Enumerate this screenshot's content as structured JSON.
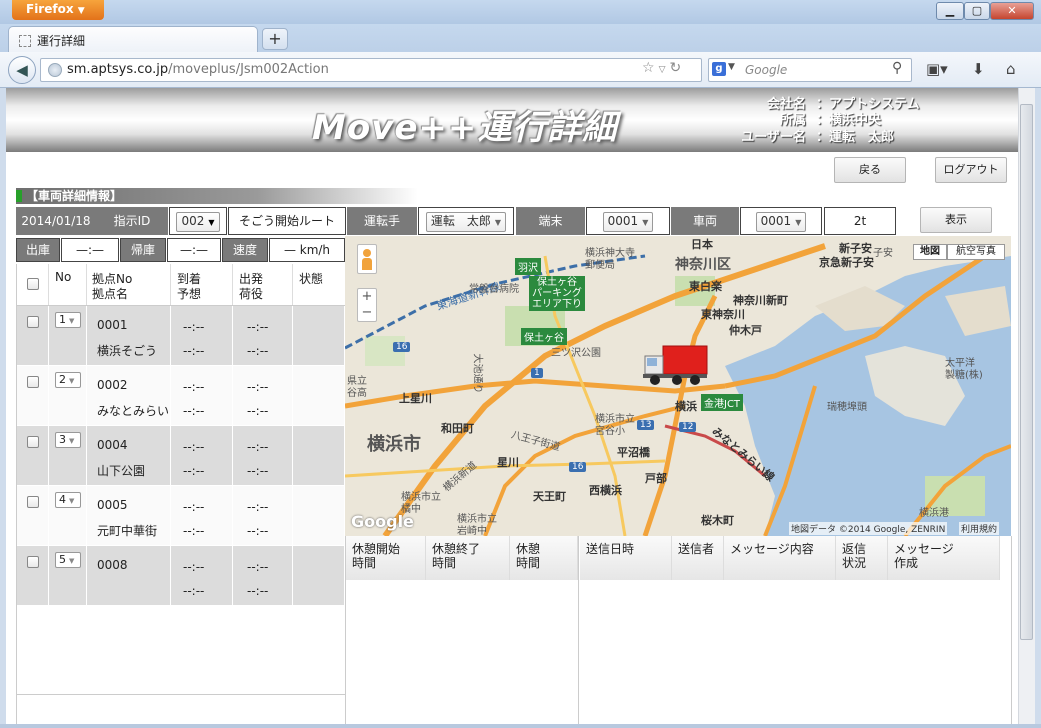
{
  "browser": {
    "app_button": "Firefox",
    "tab_title": "運行詳細",
    "url_domain": "sm.aptsys.co.jp",
    "url_path": "/moveplus/Jsm002Action",
    "search_placeholder": "Google"
  },
  "header": {
    "app_title": "Move++運行詳細",
    "company_label": "会社名",
    "company_value": "：アプトシステム",
    "branch_label": "所属",
    "branch_value": "：横浜中央",
    "user_label": "ユーザー名",
    "user_value": "：運転　太郎"
  },
  "actions": {
    "back_label": "戻る",
    "logout_label": "ログアウト",
    "display_label": "表示"
  },
  "section_title": "【車両詳細情報】",
  "info_row": {
    "date": "2014/01/18",
    "instruction_id_label": "指示ID",
    "instruction_id_value": "002",
    "route_name": "そごう開始ルート",
    "driver_label": "運転手",
    "driver_value": "運転　太郎",
    "terminal_label": "端末",
    "terminal_value": "0001",
    "vehicle_label": "車両",
    "vehicle_value": "0001",
    "tonnage": "2t"
  },
  "status_row": {
    "depart_label": "出庫",
    "depart_value": "—:—",
    "return_label": "帰庫",
    "return_value": "—:—",
    "speed_label": "速度",
    "speed_value": "— km/h"
  },
  "table": {
    "headers": {
      "no": "No",
      "point_no": "拠点No",
      "point_name": "拠点名",
      "arrival_1": "到着",
      "arrival_2": "予想",
      "departure_1": "出発",
      "departure_2": "荷役",
      "status": "状態"
    },
    "rows": [
      {
        "no": "1",
        "code": "0001",
        "name": "横浜そごう",
        "arr1": "--:--",
        "arr2": "--:--",
        "dep1": "--:--",
        "dep2": "--:--"
      },
      {
        "no": "2",
        "code": "0002",
        "name": "みなとみらい",
        "arr1": "--:--",
        "arr2": "--:--",
        "dep1": "--:--",
        "dep2": "--:--"
      },
      {
        "no": "3",
        "code": "0004",
        "name": "山下公園",
        "arr1": "--:--",
        "arr2": "--:--",
        "dep1": "--:--",
        "dep2": "--:--"
      },
      {
        "no": "4",
        "code": "0005",
        "name": "元町中華街",
        "arr1": "--:--",
        "arr2": "--:--",
        "dep1": "--:--",
        "dep2": "--:--"
      },
      {
        "no": "5",
        "code": "0008",
        "name": "",
        "arr1": "--:--",
        "arr2": "--:--",
        "dep1": "--:--",
        "dep2": "--:--"
      }
    ]
  },
  "map": {
    "btn_map": "地図",
    "btn_aerial": "航空写真",
    "zoom_in": "+",
    "zoom_out": "−",
    "copyright": "地図データ ©2014 Google, ZENRIN",
    "terms": "利用規約",
    "google_logo": "Google",
    "labels": {
      "kanagawa_ward": "神奈川区",
      "yokohama_city": "横浜市",
      "hodogaya": "保土ヶ谷",
      "hodogaya_parking_1": "保土ヶ谷",
      "hodogaya_parking_2": "パーキング",
      "hodogaya_parking_3": "エリア下り",
      "hazawa": "羽沢",
      "tokaido": "東海道新幹線",
      "jogan": "常盤台病院",
      "mitsuzawa": "三ツ沢公園",
      "yokohama_st": "横浜",
      "kinko_jct": "金港JCT",
      "minatomirai": "みなとみらい線",
      "hiranuma": "平沼橋",
      "tobe": "戸部",
      "nishiyokohama": "西横浜",
      "tenno": "天王町",
      "hoshikawa": "星川",
      "wadamachi": "和田町",
      "kamihoshikawa": "上星川",
      "sakuragicho": "桜木町",
      "yokohamako": "横浜港",
      "mizuho": "瑞穂埠頭",
      "taiheiyo_1": "太平洋",
      "taiheiyo_2": "製糖(株)",
      "shinkoyasu": "新子安",
      "keikyu_shinkoyasu": "京急新子安",
      "higashihakuraku": "東白楽",
      "kanagawashinmachi": "神奈川新町",
      "higashikanagawa": "東神奈川",
      "nakakido": "仲木戸",
      "kanagawa_univ_1": "横浜神大寺",
      "kanagawa_univ_2": "郵便局",
      "hinode": "日本",
      "koyasu": "子安",
      "hachiouji": "八王子街道",
      "yokohama_city_hall_1": "横浜市立",
      "yokohama_city_hall_2": "宮谷小",
      "yokohama_tokiwa_1": "横浜市立",
      "yokohama_tokiwa_2": "橘中",
      "yokohama_iwasaki_1": "横浜市立",
      "yokohama_iwasaki_2": "岩崎中",
      "yokohama_shinmachi": "横浜新道",
      "omiyadori": "大池通り",
      "kenritsu_1": "県立",
      "kenritsu_2": "谷高",
      "route_16a": "16",
      "route_16b": "16",
      "route_1": "1",
      "route_13": "13",
      "route_12": "12"
    }
  },
  "rest_panel": {
    "start_1": "休憩開始",
    "start_2": "時間",
    "end_1": "休憩終了",
    "end_2": "時間",
    "rest_1": "休憩",
    "rest_2": "時間"
  },
  "message_panel": {
    "sent_at": "送信日時",
    "sender": "送信者",
    "content": "メッセージ内容",
    "reply_1": "返信",
    "reply_2": "状況",
    "create_1": "メッセージ",
    "create_2": "作成"
  },
  "colors": {
    "header_dark": "#7a7a7a",
    "section_green": "#27a02a",
    "map_water": "#a6c4e0",
    "road_orange": "#f2a33a"
  }
}
